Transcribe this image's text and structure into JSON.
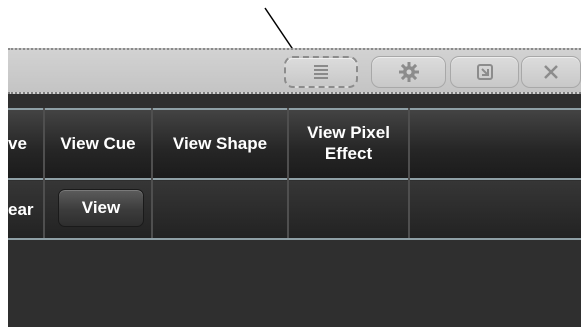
{
  "toolbar": {
    "icons": [
      "menu-icon",
      "gear-icon",
      "restore-icon",
      "close-icon"
    ]
  },
  "table": {
    "headers": [
      "ve",
      "View Cue",
      "View Shape",
      "View Pixel Effect",
      ""
    ],
    "row": {
      "col0": "ear",
      "view_button": "View"
    }
  },
  "colors": {
    "titlebar": "#c8c8c8",
    "panel": "#2f2f2f",
    "grid_line": "#8fa0a6"
  }
}
